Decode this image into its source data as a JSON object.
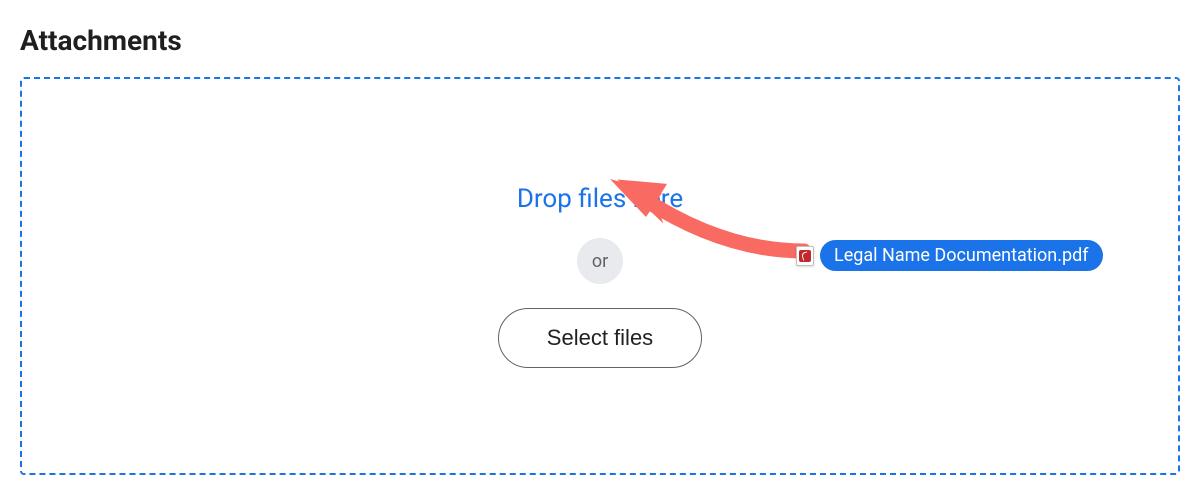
{
  "section": {
    "title": "Attachments"
  },
  "dropzone": {
    "drop_text": "Drop files here",
    "or_label": "or",
    "select_button_label": "Select files"
  },
  "drag_file": {
    "name": "Legal Name Documentation.pdf",
    "icon": "pdf-icon"
  }
}
